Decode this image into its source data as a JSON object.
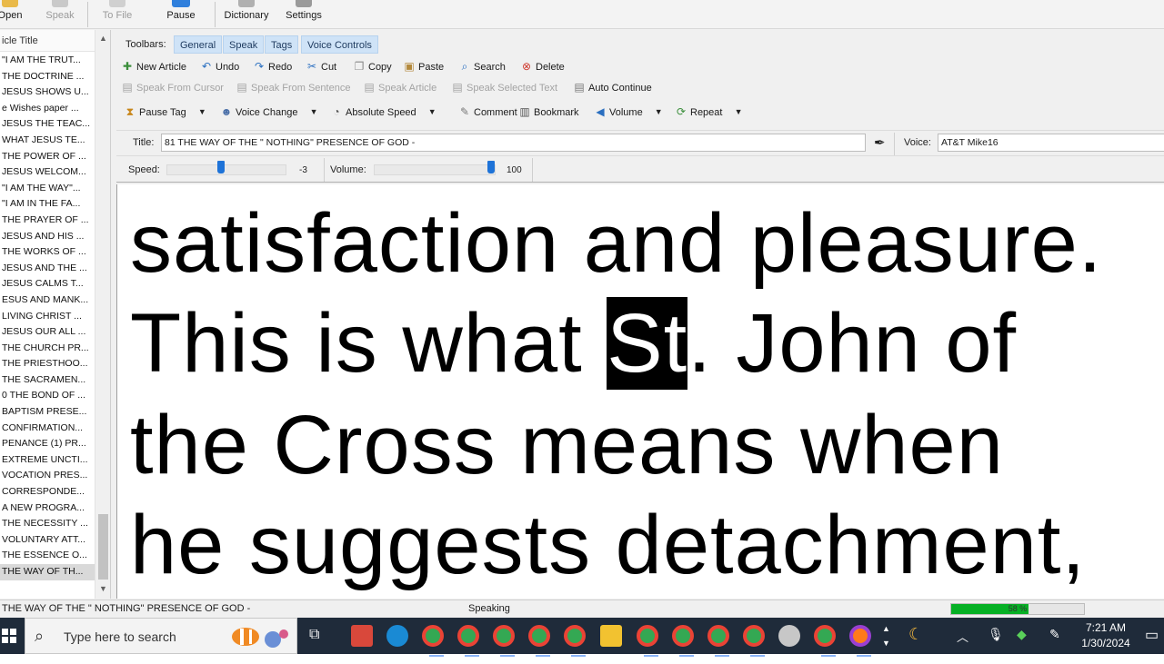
{
  "toolbar_top": {
    "open": "Open",
    "speak": "Speak",
    "to_file": "To File",
    "pause": "Pause",
    "dictionary": "Dictionary",
    "settings": "Settings"
  },
  "left_pane": {
    "header": "icle Title",
    "items": [
      "\"I AM THE TRUT...",
      "THE DOCTRINE ...",
      "JESUS SHOWS U...",
      "e Wishes paper ...",
      "JESUS THE TEAC...",
      "WHAT JESUS TE...",
      "THE POWER OF ...",
      "JESUS WELCOM...",
      "\"I AM THE WAY\"...",
      "\"I AM IN THE FA...",
      "THE PRAYER OF ...",
      "JESUS AND HIS ...",
      "THE WORKS OF ...",
      "JESUS AND THE ...",
      "JESUS CALMS T...",
      "ESUS AND MANK...",
      "LIVING CHRIST ...",
      "JESUS OUR ALL ...",
      "THE CHURCH PR...",
      "THE PRIESTHOO...",
      "THE SACRAMEN...",
      "0 THE BOND OF ...",
      "BAPTISM PRESE...",
      "CONFIRMATION...",
      "PENANCE (1) PR...",
      "EXTREME UNCTI...",
      "VOCATION PRES...",
      "CORRESPONDE...",
      "A NEW PROGRA...",
      "THE NECESSITY ...",
      "VOLUNTARY ATT...",
      "THE ESSENCE O...",
      "THE WAY OF TH..."
    ],
    "selected_index": 32
  },
  "toolbars": {
    "label": "Toolbars:",
    "tabs": [
      "General",
      "Speak",
      "Tags",
      "Voice Controls"
    ]
  },
  "general": {
    "new_article": "New Article",
    "undo": "Undo",
    "redo": "Redo",
    "cut": "Cut",
    "copy": "Copy",
    "paste": "Paste",
    "search": "Search",
    "delete": "Delete"
  },
  "speak": {
    "from_cursor": "Speak From Cursor",
    "from_sentence": "Speak From Sentence",
    "article": "Speak Article",
    "selected_text": "Speak Selected Text",
    "auto_continue": "Auto Continue"
  },
  "tags": {
    "pause_tag": "Pause Tag",
    "voice_change": "Voice Change",
    "absolute_speed": "Absolute Speed",
    "comment": "Comment",
    "bookmark": "Bookmark",
    "volume": "Volume",
    "repeat": "Repeat"
  },
  "title_row": {
    "title_label": "Title:",
    "title_value": "81 THE WAY OF THE \" NOTHING\" PRESENCE OF GOD -",
    "voice_label": "Voice:",
    "voice_value": "AT&T Mike16"
  },
  "controls": {
    "speed_label": "Speed:",
    "speed_value": "-3",
    "speed_fraction": 0.45,
    "volume_label": "Volume:",
    "volume_value": "100",
    "volume_fraction": 1.0
  },
  "content": {
    "line1": "satisfaction and pleasure.",
    "line2_before": "This is what ",
    "line2_highlight": "St",
    "line2_after": ". John of",
    "line3": "the Cross means when",
    "line4": "he suggests detachment,"
  },
  "status": {
    "article": "THE WAY OF THE \" NOTHING\" PRESENCE OF GOD -",
    "state": "Speaking",
    "progress_text": "58 %",
    "progress_value": 0.58
  },
  "taskbar": {
    "search_placeholder": "Type here to search",
    "time": "7:21 AM",
    "date": "1/30/2024"
  }
}
